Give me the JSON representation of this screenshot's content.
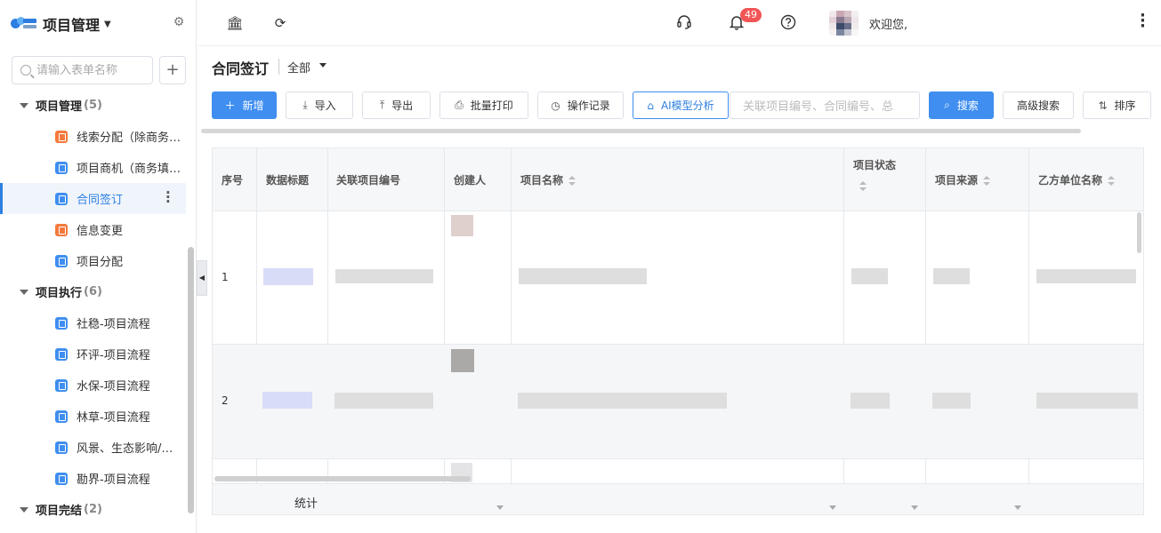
{
  "brand": {
    "title": "项目管理"
  },
  "sidebar": {
    "search_placeholder": "请输入表单名称",
    "groups": [
      {
        "label": "项目管理",
        "count": "(5)",
        "items": [
          "线索分配（除商务…",
          "项目商机（商务填…",
          "合同签订",
          "信息变更",
          "项目分配"
        ]
      },
      {
        "label": "项目执行",
        "count": "(6)",
        "items": [
          "社稳-项目流程",
          "环评-项目流程",
          "水保-项目流程",
          "林草-项目流程",
          "风景、生态影响/…",
          "勘界-项目流程"
        ]
      },
      {
        "label": "项目完结",
        "count": "(2)",
        "items": []
      }
    ]
  },
  "topbar": {
    "notification_count": "49",
    "welcome": "欢迎您,"
  },
  "page": {
    "title": "合同签订",
    "filter": "全部"
  },
  "toolbar": {
    "new": "新增",
    "import": "导入",
    "export": "导出",
    "batch_print": "批量打印",
    "op_log": "操作记录",
    "ai_analysis": "AI模型分析",
    "keyword_placeholder": "关联项目编号、合同编号、总",
    "search": "搜索",
    "advanced_search": "高级搜索",
    "sort": "排序"
  },
  "table": {
    "columns": [
      "序号",
      "数据标题",
      "关联项目编号",
      "创建人",
      "项目名称",
      "项目状态",
      "项目来源",
      "乙方单位名称"
    ],
    "rows": [
      {
        "index": "1"
      },
      {
        "index": "2"
      }
    ],
    "footer_label": "统计"
  },
  "colors": {
    "primary": "#3f8ef0",
    "badge": "#f25555",
    "active_bg": "#f0f5fc"
  }
}
